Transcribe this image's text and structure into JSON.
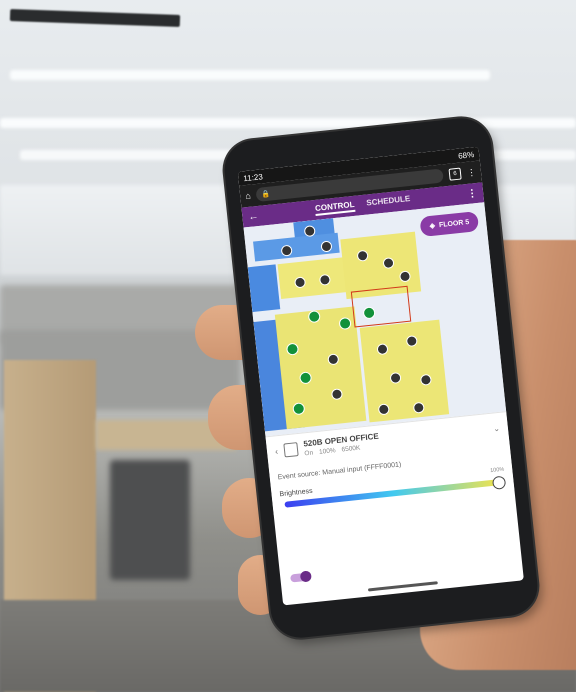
{
  "status_bar": {
    "time": "11:23",
    "battery": "68%"
  },
  "browser": {
    "url": "",
    "tab_count": "6"
  },
  "app_bar": {
    "tabs": [
      {
        "label": "CONTROL"
      },
      {
        "label": "SCHEDULE"
      }
    ]
  },
  "map": {
    "floor_button": "FLOOR 5"
  },
  "room": {
    "name": "520B OPEN OFFICE",
    "state": "On",
    "level": "100%",
    "color_temp": "6500K"
  },
  "event_source": "Event source: Manual input (FFFF0001)",
  "brightness": {
    "label": "Brightness",
    "value_label": "100%",
    "value": 100
  },
  "colors": {
    "accent": "#6a2c87",
    "fixture_on": "#12913a",
    "selection": "#d23a1a"
  }
}
